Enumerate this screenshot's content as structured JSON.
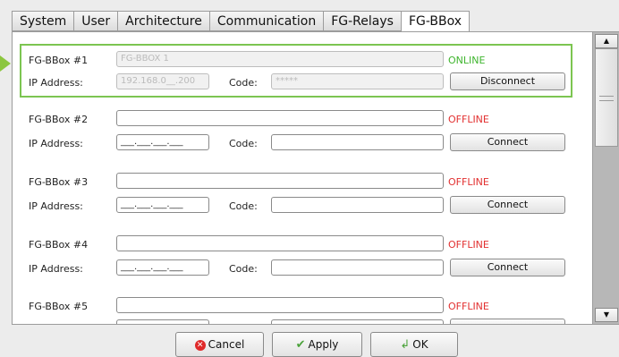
{
  "tabs": [
    {
      "label": "System"
    },
    {
      "label": "User"
    },
    {
      "label": "Architecture"
    },
    {
      "label": "Communication"
    },
    {
      "label": "FG-Relays"
    },
    {
      "label": "FG-BBox",
      "active": true
    }
  ],
  "bboxes": [
    {
      "title": "FG-BBox #1",
      "name_value": "FG-BBOX 1",
      "ip_label": "IP Address:",
      "ip_value": "192.168.0__.200",
      "code_label": "Code:",
      "code_value": "*****",
      "status": "ONLINE",
      "button": "Disconnect"
    },
    {
      "title": "FG-BBox #2",
      "name_value": "",
      "ip_label": "IP Address:",
      "ip_value": "___.___.___.___",
      "code_label": "Code:",
      "code_value": "",
      "status": "OFFLINE",
      "button": "Connect"
    },
    {
      "title": "FG-BBox #3",
      "name_value": "",
      "ip_label": "IP Address:",
      "ip_value": "___.___.___.___",
      "code_label": "Code:",
      "code_value": "",
      "status": "OFFLINE",
      "button": "Connect"
    },
    {
      "title": "FG-BBox #4",
      "name_value": "",
      "ip_label": "IP Address:",
      "ip_value": "___.___.___.___",
      "code_label": "Code:",
      "code_value": "",
      "status": "OFFLINE",
      "button": "Connect"
    },
    {
      "title": "FG-BBox #5",
      "name_value": "",
      "status": "OFFLINE"
    }
  ],
  "footer": {
    "cancel": "Cancel",
    "apply": "Apply",
    "ok": "OK"
  },
  "colors": {
    "online": "#3fb52e",
    "offline": "#e23030",
    "highlight": "#7cc551"
  },
  "icons": {
    "cancel": "cancel-circle-icon",
    "apply": "checkmark-icon",
    "ok": "enter-arrow-icon",
    "pointer": "arrow-right-icon"
  }
}
